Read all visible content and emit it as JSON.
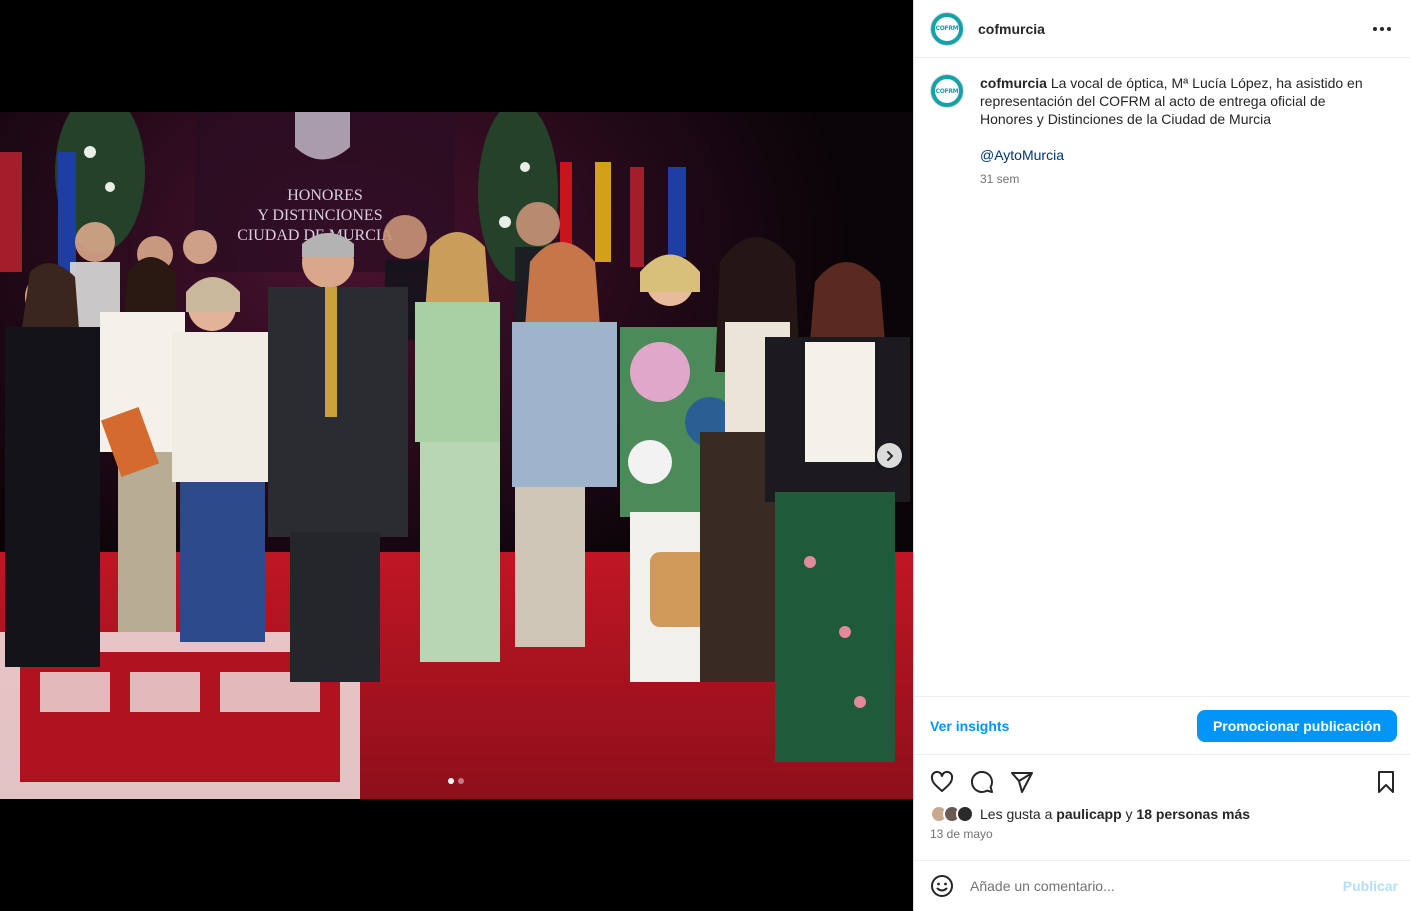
{
  "post": {
    "username": "cofmurcia",
    "avatar_mark": "COFRM",
    "caption_text": "La vocal de óptica, Mª Lucía López, ha asistido en representación del COFRM al acto de entrega oficial de Honores y Distinciones de la Ciudad de Murcia",
    "mention": "@AytoMurcia",
    "age": "31 sem",
    "date": "13 de mayo"
  },
  "photo": {
    "banner_line1": "HONORES",
    "banner_line2": "Y DISTINCIONES",
    "banner_line3": "CIUDAD DE MURCIA",
    "slide_index": 1,
    "slide_count": 2
  },
  "insights": {
    "link_label": "Ver insights",
    "promote_label": "Promocionar publicación"
  },
  "likes": {
    "prefix": "Les gusta a ",
    "user": "paulicapp",
    "connector": " y ",
    "others": "18 personas más"
  },
  "comment": {
    "placeholder": "Añade un comentario...",
    "publish_label": "Publicar"
  },
  "colors": {
    "accent": "#0095f6",
    "brand_teal": "#12a3a8",
    "carpet_red": "#a8121f"
  },
  "icons": [
    "more-options-icon",
    "chevron-right-icon",
    "heart-icon",
    "comment-icon",
    "share-icon",
    "bookmark-icon",
    "emoji-icon"
  ]
}
